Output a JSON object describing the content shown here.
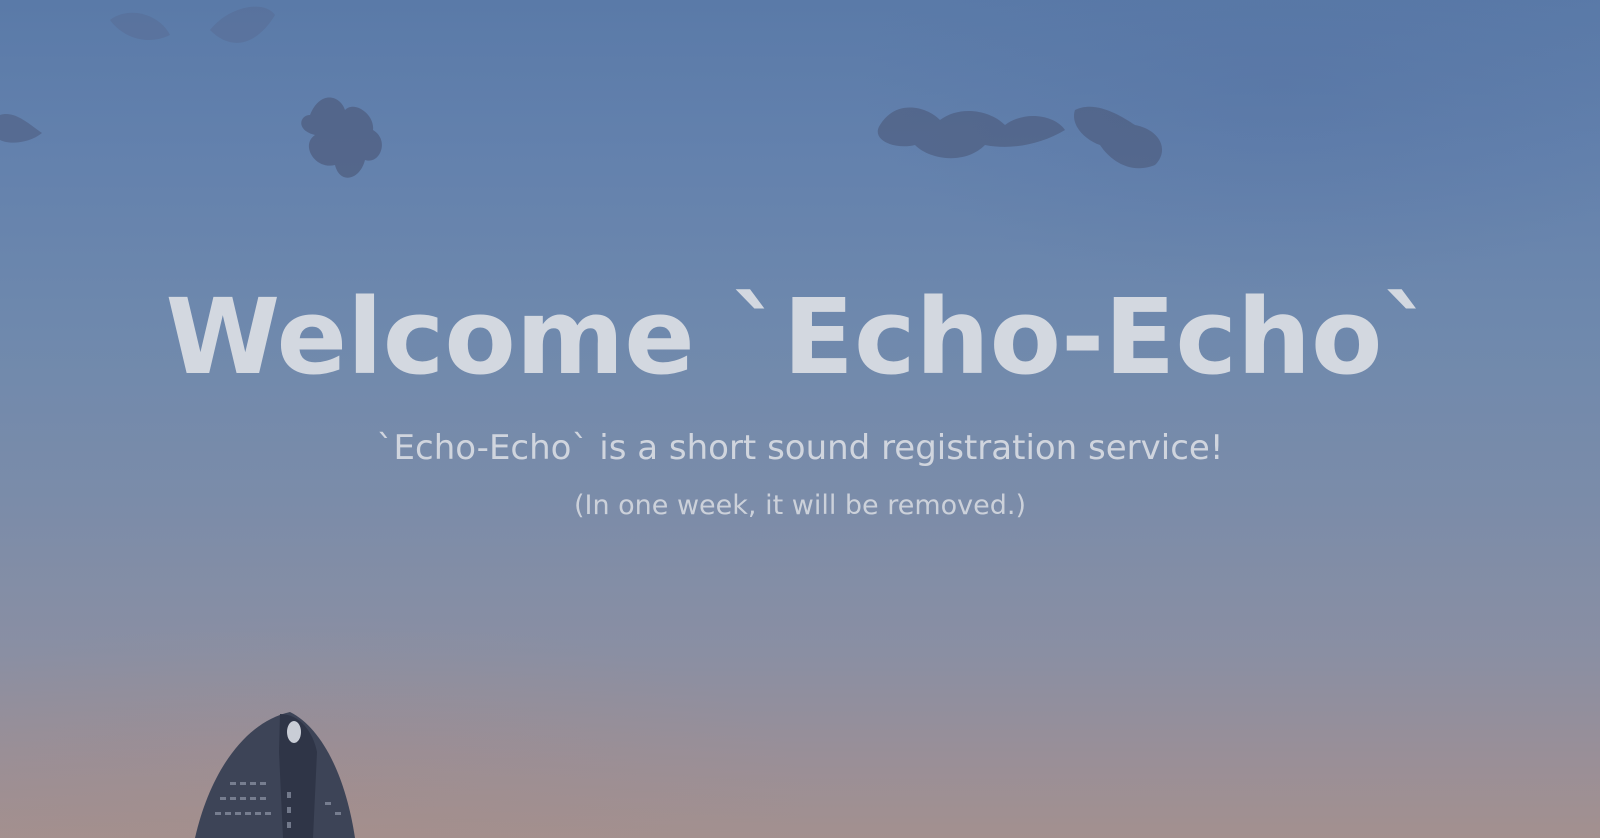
{
  "hero": {
    "title": "Welcome `Echo-Echo`",
    "subtitle": "`Echo-Echo` is a short sound registration service!",
    "note": "(In one week, it will be removed.)"
  },
  "colors": {
    "text": "#d3d8e0",
    "sky_top": "#5a7aa8",
    "sky_bottom": "#a3908f"
  }
}
